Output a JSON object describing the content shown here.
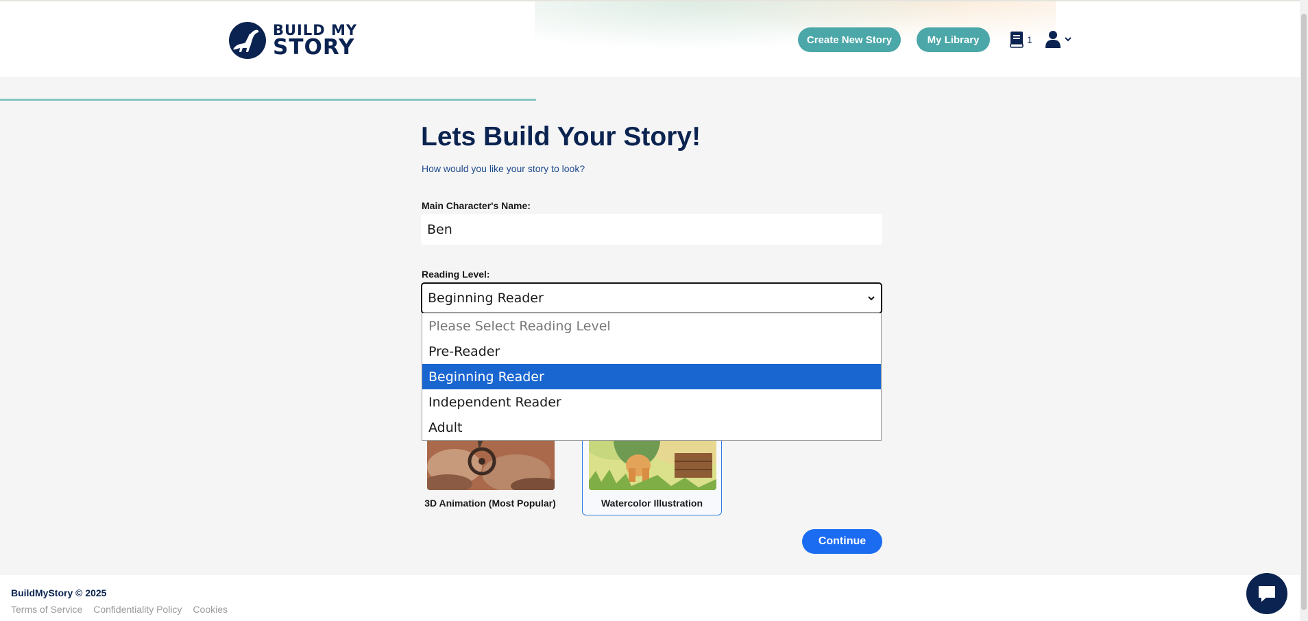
{
  "header": {
    "logo": {
      "line1": "BUILD MY",
      "line2": "STORY"
    },
    "create_button": "Create New Story",
    "library_button": "My Library",
    "book_count": "1",
    "icons": {
      "book": "book-icon",
      "user": "user-icon",
      "menu_caret": "chevron-down-icon"
    }
  },
  "progress": {
    "fraction": 0.5
  },
  "main": {
    "title": "Lets Build Your Story!",
    "subtitle": "How would you like your story to look?",
    "name_label": "Main Character's Name:",
    "name_value": "Ben",
    "level_label": "Reading Level:",
    "level_selected": "Beginning Reader",
    "level_options": [
      "Please Select Reading Level",
      "Pre-Reader",
      "Beginning Reader",
      "Independent Reader",
      "Adult"
    ],
    "selected_index": 2,
    "styles": [
      {
        "label": "3D Animation (Most Popular)",
        "selected": false
      },
      {
        "label": "Watercolor Illustration",
        "selected": true
      }
    ],
    "continue_button": "Continue"
  },
  "footer": {
    "copyright": "BuildMyStory © 2025",
    "links": [
      "Terms of Service",
      "Confidentiality Policy",
      "Cookies"
    ]
  },
  "colors": {
    "navy": "#0b2350",
    "teal": "#4ba7a8",
    "progress": "#84c6c4",
    "blue": "#1c6cf2",
    "selected_option": "#1a66d1"
  }
}
